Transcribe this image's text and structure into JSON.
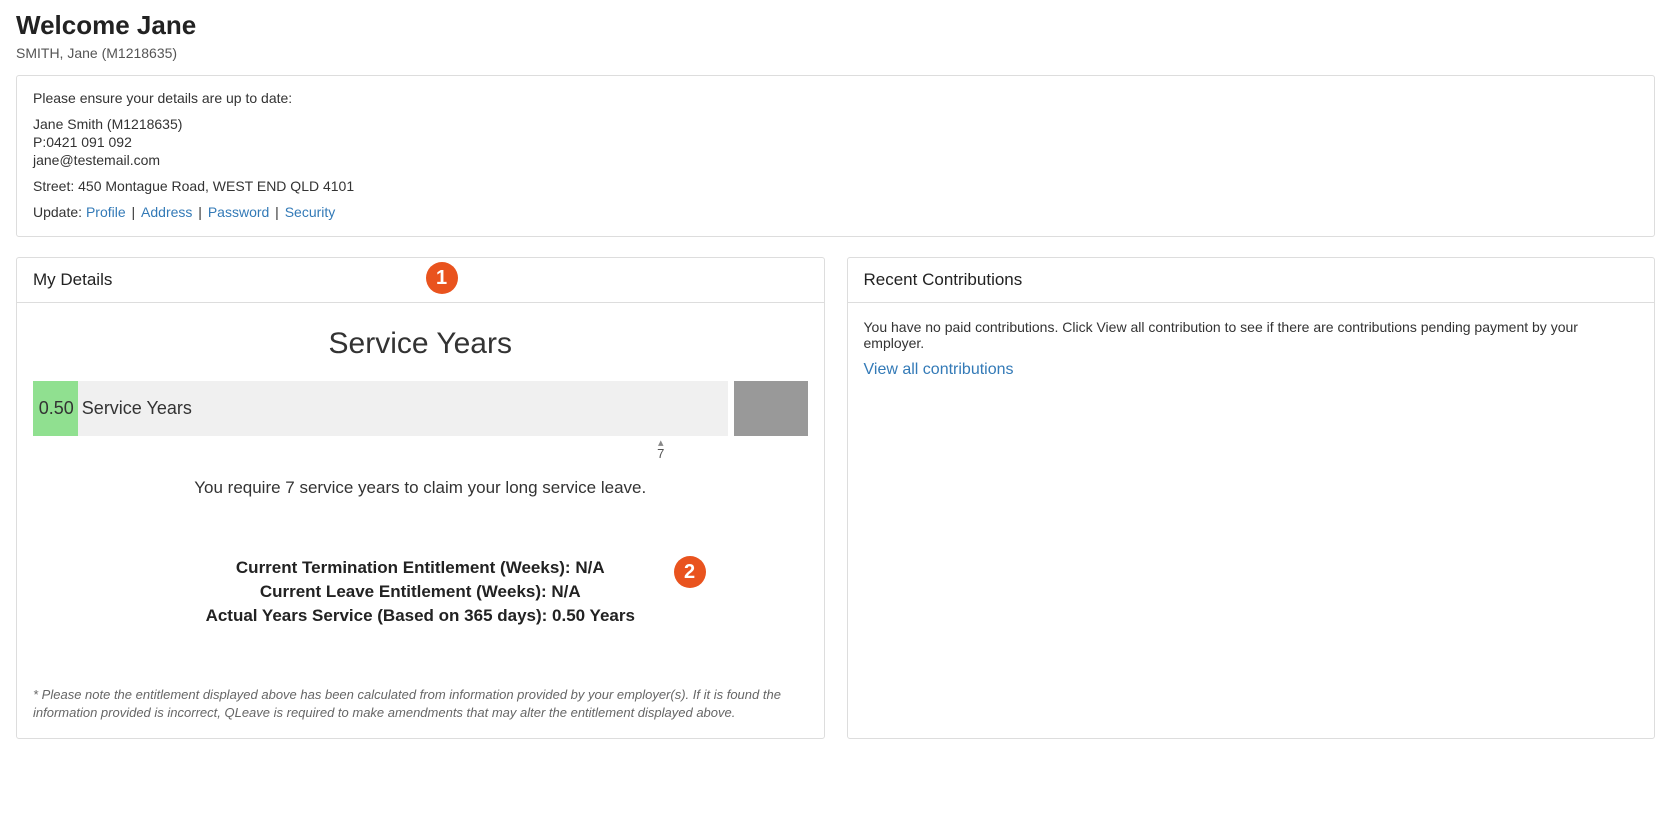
{
  "header": {
    "welcome": "Welcome Jane",
    "subtitle": "SMITH, Jane (M1218635)"
  },
  "details": {
    "ensure": "Please ensure your details are up to date:",
    "name_line": "Jane Smith (M1218635)",
    "phone_line": "P:0421 091 092",
    "email_line": "jane@testemail.com",
    "address_line": "Street: 450 Montague Road, WEST END QLD 4101",
    "update_label": "Update:",
    "profile": "Profile",
    "address": "Address",
    "password": "Password",
    "security": "Security",
    "sep": " | "
  },
  "my_details": {
    "heading": "My Details",
    "service_years_title": "Service Years",
    "requirement_text": "You require 7 service years to claim your long service leave.",
    "entitlement": {
      "termination": "Current Termination Entitlement (Weeks): N/A",
      "leave": "Current Leave Entitlement (Weeks): N/A",
      "actual": "Actual Years Service (Based on 365 days): 0.50 Years"
    },
    "disclaimer": "* Please note the entitlement displayed above has been calculated from information provided by your employer(s). If it is found the information provided is incorrect, QLeave is required to make amendments that may alter the entitlement displayed above."
  },
  "contributions": {
    "heading": "Recent Contributions",
    "message": "You have no paid contributions. Click View all contribution to see if there are contributions pending payment by your employer.",
    "view_all": "View all contributions"
  },
  "callouts": {
    "one": "1",
    "two": "2"
  },
  "chart_data": {
    "type": "bar",
    "title": "Service Years",
    "orientation": "horizontal",
    "series": [
      {
        "name": "Service Years",
        "value": 0.5,
        "value_display": "0.50",
        "bar_text": "Service Years"
      }
    ],
    "threshold": 7,
    "threshold_display": "7",
    "bar_range_max": 7.75,
    "fill_color": "#90e090",
    "track_color": "#f0f0f0",
    "extra_color": "#999999"
  }
}
